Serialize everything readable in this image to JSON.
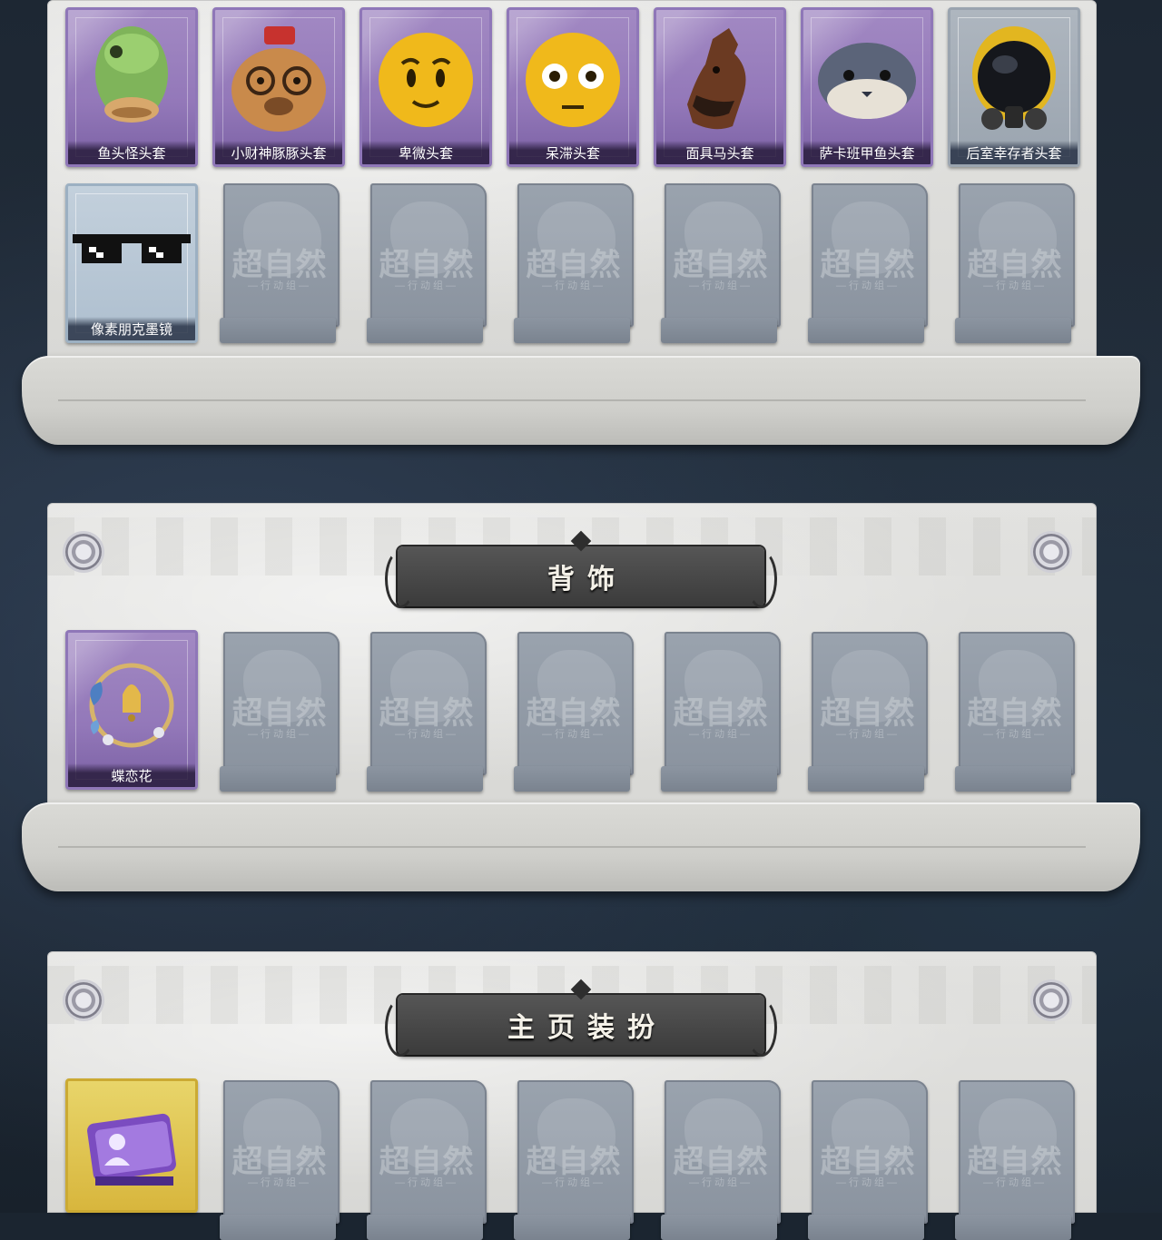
{
  "headwear": {
    "row1": [
      {
        "name": "鱼头怪头套",
        "icon": "fish-head-mask-icon"
      },
      {
        "name": "小财神豚豚头套",
        "icon": "capybara-mask-icon"
      },
      {
        "name": "卑微头套",
        "icon": "humble-face-mask-icon"
      },
      {
        "name": "呆滞头套",
        "icon": "dazed-face-mask-icon"
      },
      {
        "name": "面具马头套",
        "icon": "horse-mask-icon"
      },
      {
        "name": "萨卡班甲鱼头套",
        "icon": "sacabambaspis-mask-icon"
      },
      {
        "name": "后室幸存者头套",
        "icon": "gas-mask-helmet-icon"
      }
    ],
    "row2": [
      {
        "name": "像素朋克墨镜",
        "icon": "pixel-sunglasses-icon"
      }
    ]
  },
  "back_accessory": {
    "title": "背饰",
    "items": [
      {
        "name": "蝶恋花",
        "icon": "butterfly-bell-wreath-icon"
      }
    ]
  },
  "homepage_decor": {
    "title": "主页装扮",
    "items": [
      {
        "name": "",
        "icon": "profile-card-icon"
      }
    ]
  },
  "empty_slot": {
    "mark": "超自然",
    "sub": "—行动组—"
  },
  "colors": {
    "purple_card": "#9378b9",
    "blue_card": "#aebfcf",
    "gold_card": "#d8b63d",
    "banner": "#3b3b3b"
  }
}
